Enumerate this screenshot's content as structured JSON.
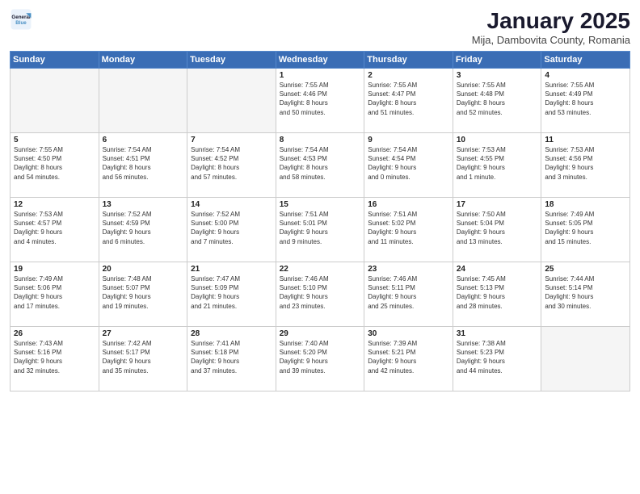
{
  "logo": {
    "line1": "General",
    "line2": "Blue"
  },
  "title": "January 2025",
  "subtitle": "Mija, Dambovita County, Romania",
  "days_of_week": [
    "Sunday",
    "Monday",
    "Tuesday",
    "Wednesday",
    "Thursday",
    "Friday",
    "Saturday"
  ],
  "weeks": [
    [
      {
        "day": "",
        "info": ""
      },
      {
        "day": "",
        "info": ""
      },
      {
        "day": "",
        "info": ""
      },
      {
        "day": "1",
        "info": "Sunrise: 7:55 AM\nSunset: 4:46 PM\nDaylight: 8 hours\nand 50 minutes."
      },
      {
        "day": "2",
        "info": "Sunrise: 7:55 AM\nSunset: 4:47 PM\nDaylight: 8 hours\nand 51 minutes."
      },
      {
        "day": "3",
        "info": "Sunrise: 7:55 AM\nSunset: 4:48 PM\nDaylight: 8 hours\nand 52 minutes."
      },
      {
        "day": "4",
        "info": "Sunrise: 7:55 AM\nSunset: 4:49 PM\nDaylight: 8 hours\nand 53 minutes."
      }
    ],
    [
      {
        "day": "5",
        "info": "Sunrise: 7:55 AM\nSunset: 4:50 PM\nDaylight: 8 hours\nand 54 minutes."
      },
      {
        "day": "6",
        "info": "Sunrise: 7:54 AM\nSunset: 4:51 PM\nDaylight: 8 hours\nand 56 minutes."
      },
      {
        "day": "7",
        "info": "Sunrise: 7:54 AM\nSunset: 4:52 PM\nDaylight: 8 hours\nand 57 minutes."
      },
      {
        "day": "8",
        "info": "Sunrise: 7:54 AM\nSunset: 4:53 PM\nDaylight: 8 hours\nand 58 minutes."
      },
      {
        "day": "9",
        "info": "Sunrise: 7:54 AM\nSunset: 4:54 PM\nDaylight: 9 hours\nand 0 minutes."
      },
      {
        "day": "10",
        "info": "Sunrise: 7:53 AM\nSunset: 4:55 PM\nDaylight: 9 hours\nand 1 minute."
      },
      {
        "day": "11",
        "info": "Sunrise: 7:53 AM\nSunset: 4:56 PM\nDaylight: 9 hours\nand 3 minutes."
      }
    ],
    [
      {
        "day": "12",
        "info": "Sunrise: 7:53 AM\nSunset: 4:57 PM\nDaylight: 9 hours\nand 4 minutes."
      },
      {
        "day": "13",
        "info": "Sunrise: 7:52 AM\nSunset: 4:59 PM\nDaylight: 9 hours\nand 6 minutes."
      },
      {
        "day": "14",
        "info": "Sunrise: 7:52 AM\nSunset: 5:00 PM\nDaylight: 9 hours\nand 7 minutes."
      },
      {
        "day": "15",
        "info": "Sunrise: 7:51 AM\nSunset: 5:01 PM\nDaylight: 9 hours\nand 9 minutes."
      },
      {
        "day": "16",
        "info": "Sunrise: 7:51 AM\nSunset: 5:02 PM\nDaylight: 9 hours\nand 11 minutes."
      },
      {
        "day": "17",
        "info": "Sunrise: 7:50 AM\nSunset: 5:04 PM\nDaylight: 9 hours\nand 13 minutes."
      },
      {
        "day": "18",
        "info": "Sunrise: 7:49 AM\nSunset: 5:05 PM\nDaylight: 9 hours\nand 15 minutes."
      }
    ],
    [
      {
        "day": "19",
        "info": "Sunrise: 7:49 AM\nSunset: 5:06 PM\nDaylight: 9 hours\nand 17 minutes."
      },
      {
        "day": "20",
        "info": "Sunrise: 7:48 AM\nSunset: 5:07 PM\nDaylight: 9 hours\nand 19 minutes."
      },
      {
        "day": "21",
        "info": "Sunrise: 7:47 AM\nSunset: 5:09 PM\nDaylight: 9 hours\nand 21 minutes."
      },
      {
        "day": "22",
        "info": "Sunrise: 7:46 AM\nSunset: 5:10 PM\nDaylight: 9 hours\nand 23 minutes."
      },
      {
        "day": "23",
        "info": "Sunrise: 7:46 AM\nSunset: 5:11 PM\nDaylight: 9 hours\nand 25 minutes."
      },
      {
        "day": "24",
        "info": "Sunrise: 7:45 AM\nSunset: 5:13 PM\nDaylight: 9 hours\nand 28 minutes."
      },
      {
        "day": "25",
        "info": "Sunrise: 7:44 AM\nSunset: 5:14 PM\nDaylight: 9 hours\nand 30 minutes."
      }
    ],
    [
      {
        "day": "26",
        "info": "Sunrise: 7:43 AM\nSunset: 5:16 PM\nDaylight: 9 hours\nand 32 minutes."
      },
      {
        "day": "27",
        "info": "Sunrise: 7:42 AM\nSunset: 5:17 PM\nDaylight: 9 hours\nand 35 minutes."
      },
      {
        "day": "28",
        "info": "Sunrise: 7:41 AM\nSunset: 5:18 PM\nDaylight: 9 hours\nand 37 minutes."
      },
      {
        "day": "29",
        "info": "Sunrise: 7:40 AM\nSunset: 5:20 PM\nDaylight: 9 hours\nand 39 minutes."
      },
      {
        "day": "30",
        "info": "Sunrise: 7:39 AM\nSunset: 5:21 PM\nDaylight: 9 hours\nand 42 minutes."
      },
      {
        "day": "31",
        "info": "Sunrise: 7:38 AM\nSunset: 5:23 PM\nDaylight: 9 hours\nand 44 minutes."
      },
      {
        "day": "",
        "info": ""
      }
    ]
  ]
}
